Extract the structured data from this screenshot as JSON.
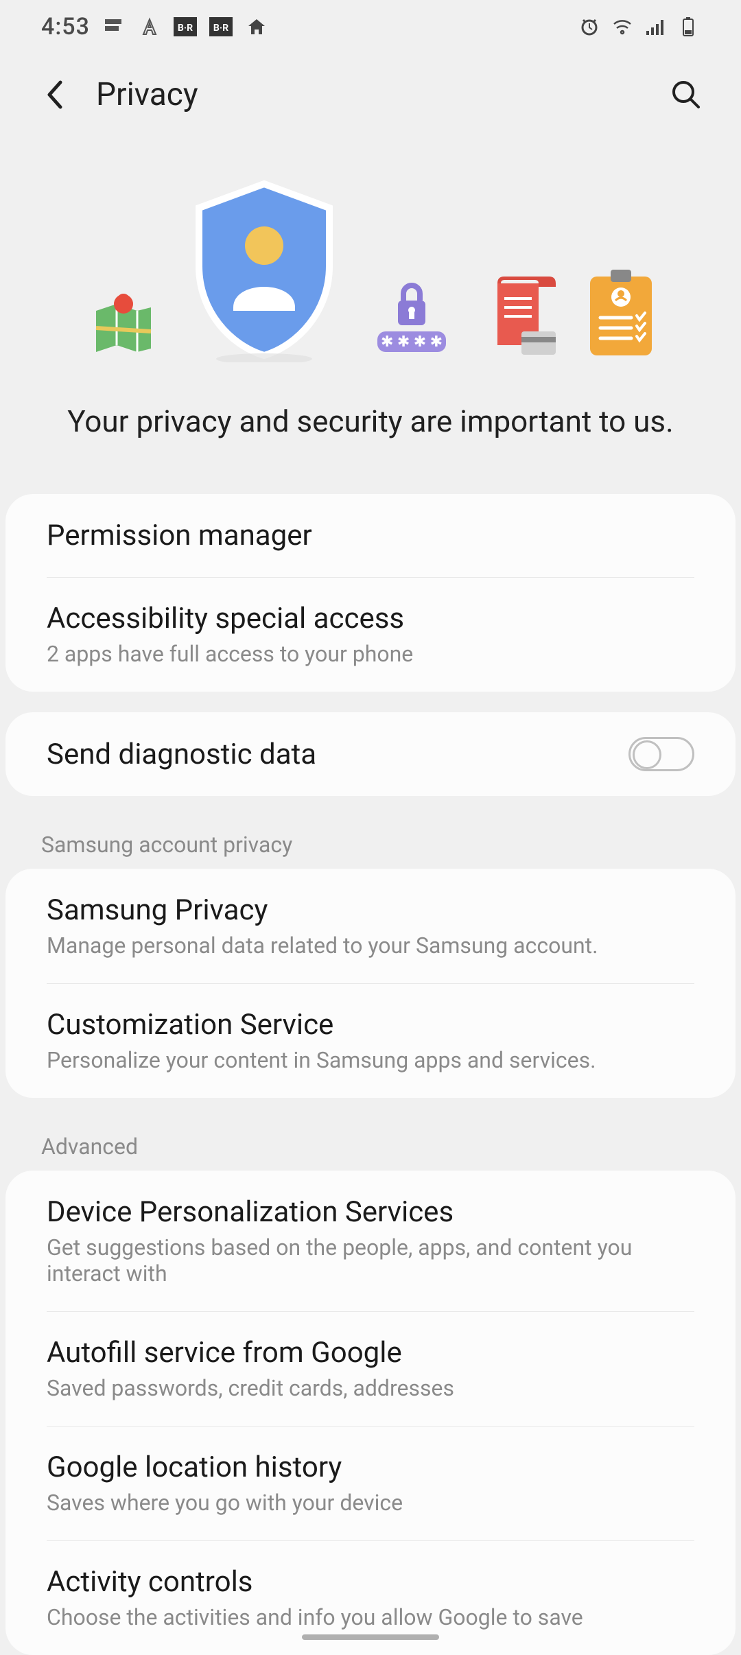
{
  "status": {
    "time": "4:53",
    "left_icons": [
      "app-icon-e",
      "app-icon-a",
      "app-icon-br",
      "app-icon-br2",
      "home-icon"
    ],
    "right_icons": [
      "alarm-icon",
      "wifi-icon",
      "signal-icon",
      "battery-icon"
    ]
  },
  "appbar": {
    "title": "Privacy"
  },
  "hero": {
    "tagline": "Your privacy and security are important to us."
  },
  "card1": {
    "permission_manager_title": "Permission manager",
    "accessibility_title": "Accessibility special access",
    "accessibility_sub": "2 apps have full access to your phone"
  },
  "card2": {
    "diagnostic_title": "Send diagnostic data",
    "diagnostic_on": false
  },
  "sections": {
    "samsung_header": "Samsung account privacy",
    "samsung_privacy_title": "Samsung Privacy",
    "samsung_privacy_sub": "Manage personal data related to your Samsung account.",
    "customization_title": "Customization Service",
    "customization_sub": "Personalize your content in Samsung apps and services.",
    "advanced_header": "Advanced",
    "device_personalization_title": "Device Personalization Services",
    "device_personalization_sub": "Get suggestions based on the people, apps, and content you interact with",
    "autofill_title": "Autofill service from Google",
    "autofill_sub": "Saved passwords, credit cards, addresses",
    "location_history_title": "Google location history",
    "location_history_sub": "Saves where you go with your device",
    "activity_controls_title": "Activity controls",
    "activity_controls_sub": "Choose the activities and info you allow Google to save"
  }
}
